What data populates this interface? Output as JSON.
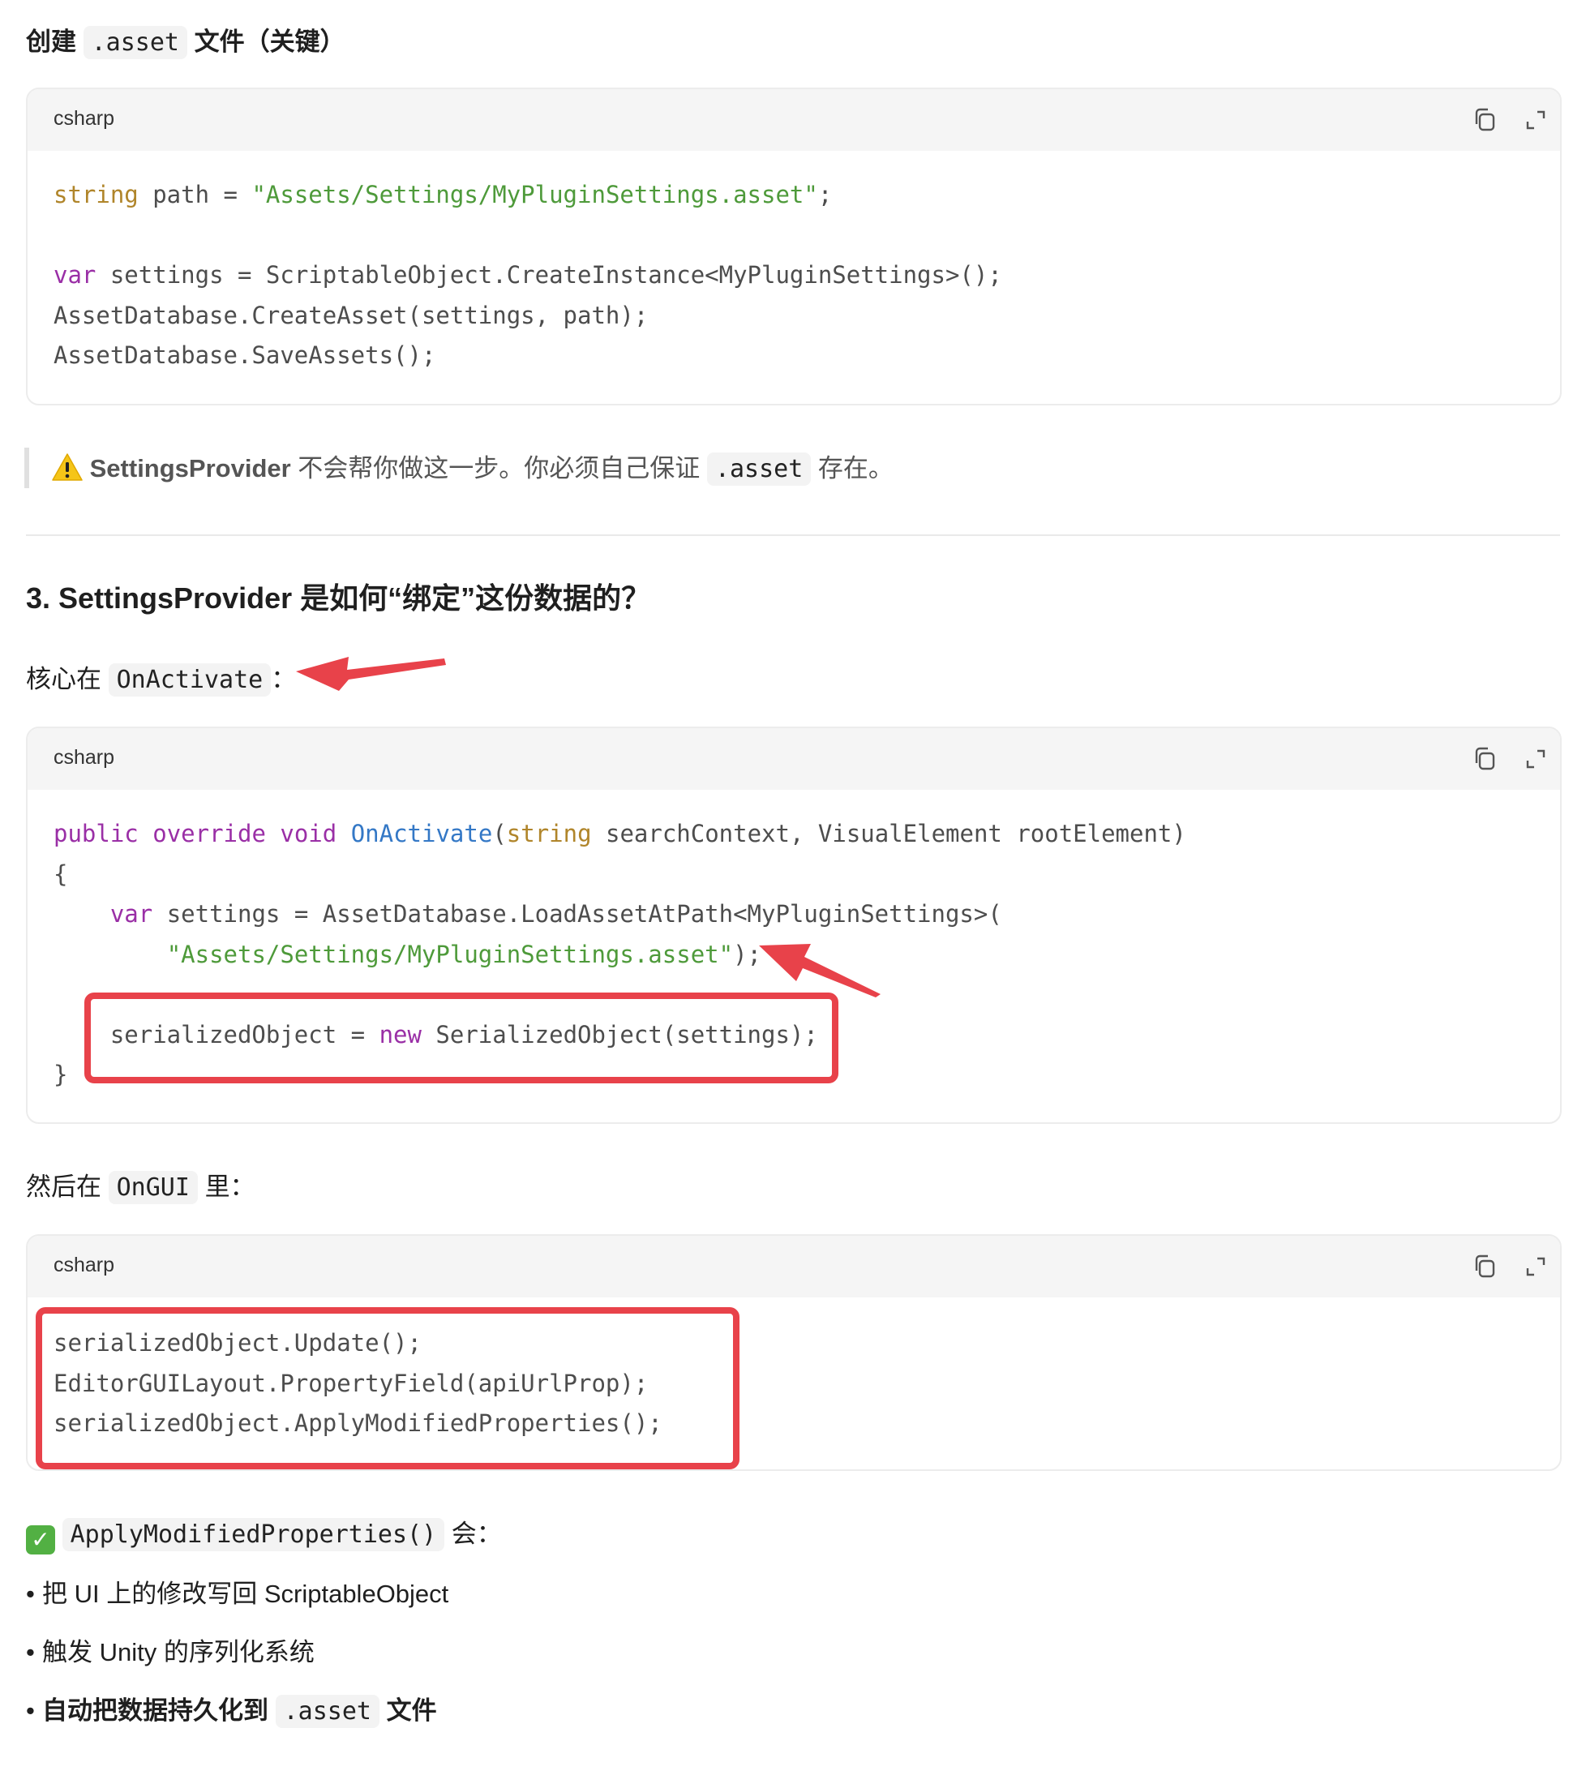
{
  "section_create": {
    "prefix": "创建",
    "code": ".asset",
    "suffix": "文件（关键）"
  },
  "code_block_1": {
    "lang": "csharp",
    "copy_icon": "copy-icon",
    "expand_icon": "expand-icon",
    "lines": [
      {
        "segments": [
          {
            "t": "string",
            "c": "kw-o"
          },
          {
            "t": " path = ",
            "c": ""
          },
          {
            "t": "\"Assets/Settings/MyPluginSettings.asset\"",
            "c": "str"
          },
          {
            "t": ";",
            "c": ""
          }
        ]
      },
      {
        "segments": []
      },
      {
        "segments": [
          {
            "t": "var",
            "c": "kw-p"
          },
          {
            "t": " settings = ScriptableObject.CreateInstance<MyPluginSettings>();",
            "c": ""
          }
        ]
      },
      {
        "segments": [
          {
            "t": "AssetDatabase.CreateAsset(settings, path);",
            "c": ""
          }
        ]
      },
      {
        "segments": [
          {
            "t": "AssetDatabase.SaveAssets();",
            "c": ""
          }
        ]
      }
    ]
  },
  "warning_quote": {
    "icon": "warning-icon",
    "bold": "SettingsProvider",
    "text": " 不会帮你做这一步。你必须自己保证 ",
    "code": ".asset",
    "suffix": " 存在。"
  },
  "section3": {
    "heading": "3. SettingsProvider 是如何“绑定”这份数据的？"
  },
  "core_para": {
    "prefix": "核心在",
    "code": "OnActivate",
    "suffix": "："
  },
  "code_block_2": {
    "lang": "csharp",
    "lines": [
      {
        "segments": [
          {
            "t": "public",
            "c": "kw-p"
          },
          {
            "t": " ",
            "c": ""
          },
          {
            "t": "override",
            "c": "kw-p"
          },
          {
            "t": " ",
            "c": ""
          },
          {
            "t": "void",
            "c": "kw-p"
          },
          {
            "t": " ",
            "c": ""
          },
          {
            "t": "OnActivate",
            "c": "fn"
          },
          {
            "t": "(",
            "c": ""
          },
          {
            "t": "string",
            "c": "kw-o"
          },
          {
            "t": " searchContext, VisualElement rootElement)",
            "c": ""
          }
        ]
      },
      {
        "segments": [
          {
            "t": "{",
            "c": ""
          }
        ]
      },
      {
        "segments": [
          {
            "t": "    ",
            "c": ""
          },
          {
            "t": "var",
            "c": "kw-p"
          },
          {
            "t": " settings = AssetDatabase.LoadAssetAtPath<MyPluginSettings>(",
            "c": ""
          }
        ]
      },
      {
        "segments": [
          {
            "t": "        ",
            "c": ""
          },
          {
            "t": "\"Assets/Settings/MyPluginSettings.asset\"",
            "c": "str"
          },
          {
            "t": ");",
            "c": ""
          }
        ]
      },
      {
        "segments": []
      },
      {
        "segments": [
          {
            "t": "    serializedObject = ",
            "c": ""
          },
          {
            "t": "new",
            "c": "kw-p"
          },
          {
            "t": " SerializedObject(settings);",
            "c": ""
          }
        ]
      },
      {
        "segments": [
          {
            "t": "}",
            "c": ""
          }
        ]
      }
    ]
  },
  "ongui_para": {
    "prefix": "然后在",
    "code": "OnGUI",
    "suffix": "里："
  },
  "code_block_3": {
    "lang": "csharp",
    "lines": [
      {
        "segments": [
          {
            "t": "serializedObject.Update();",
            "c": ""
          }
        ]
      },
      {
        "segments": [
          {
            "t": "EditorGUILayout.PropertyField(apiUrlProp);",
            "c": ""
          }
        ]
      },
      {
        "segments": [
          {
            "t": "serializedObject.ApplyModifiedProperties();",
            "c": ""
          }
        ]
      }
    ]
  },
  "apply_para": {
    "icon": "check-mark-icon",
    "code": "ApplyModifiedProperties()",
    "suffix": "会："
  },
  "bullets": [
    {
      "text": "把 UI 上的修改写回 ScriptableObject",
      "bold": false
    },
    {
      "text": "触发 Unity 的序列化系统",
      "bold": false
    },
    {
      "prefix": "自动把数据持久化到",
      "code": ".asset",
      "suffix": "文件",
      "bold": true
    }
  ],
  "colors": {
    "annotation_red": "#e8424a",
    "keyword_orange": "#b0852a",
    "keyword_purple": "#9a2fa6",
    "string_green": "#4e9a3a",
    "function_blue": "#3478c6"
  }
}
